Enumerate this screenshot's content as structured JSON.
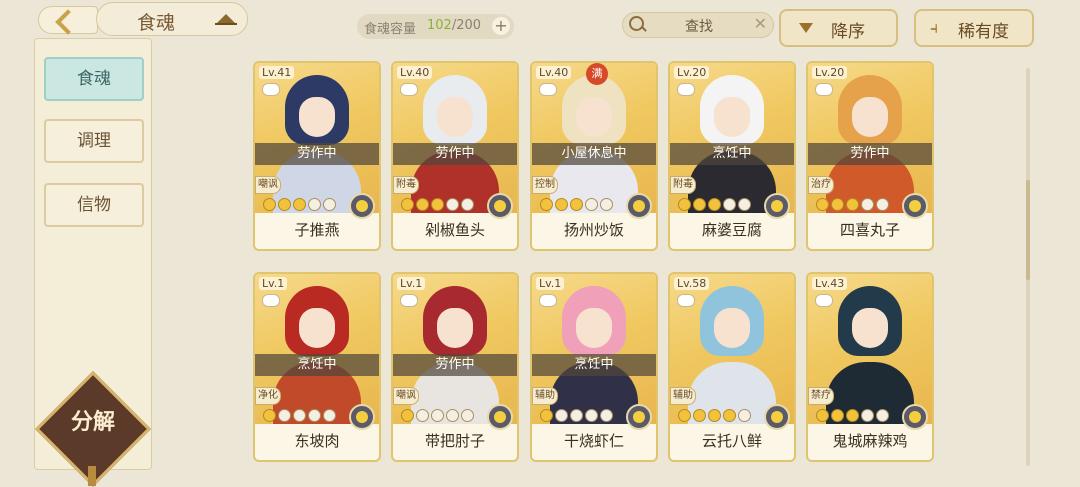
{
  "header": {
    "title": "食魂",
    "capacity_label": "食魂容量",
    "capacity_current": "102",
    "capacity_total": "/200",
    "add_label": "+",
    "search_label": "查找",
    "search_clear": "✕",
    "sort_label": "降序",
    "rarity_label": "稀有度",
    "rarity_icon": "⫞"
  },
  "sidebar": {
    "items": [
      {
        "label": "食魂",
        "active": true
      },
      {
        "label": "调理",
        "active": false
      },
      {
        "label": "信物",
        "active": false
      }
    ],
    "decompose_label": "分解"
  },
  "cards": [
    {
      "level": "Lv.41",
      "status": "劳作中",
      "tag": "嘲讽",
      "stars": 3,
      "name": "子推燕",
      "hair": "#2d3a66",
      "body": "#cfd6e6"
    },
    {
      "level": "Lv.40",
      "status": "劳作中",
      "tag": "附毒",
      "stars": 3,
      "name": "剁椒鱼头",
      "hair": "#e9ecef",
      "body": "#b0302a"
    },
    {
      "level": "Lv.40",
      "status": "小屋休息中",
      "tag": "控制",
      "stars": 3,
      "name": "扬州炒饭",
      "hair": "#efe2c0",
      "body": "#e8e8ee",
      "seal": "满"
    },
    {
      "level": "Lv.20",
      "status": "烹饪中",
      "tag": "附毒",
      "stars": 3,
      "name": "麻婆豆腐",
      "hair": "#f4f4f4",
      "body": "#2a2a30"
    },
    {
      "level": "Lv.20",
      "status": "劳作中",
      "tag": "治疗",
      "stars": 3,
      "name": "四喜丸子",
      "hair": "#e6a24a",
      "body": "#d15a2a"
    },
    {
      "level": "Lv.1",
      "status": "烹饪中",
      "tag": "净化",
      "stars": 1,
      "name": "东坡肉",
      "hair": "#b82a22",
      "body": "#c04a2a"
    },
    {
      "level": "Lv.1",
      "status": "劳作中",
      "tag": "嘲讽",
      "stars": 1,
      "name": "带把肘子",
      "hair": "#a82a30",
      "body": "#e8e4e0"
    },
    {
      "level": "Lv.1",
      "status": "烹饪中",
      "tag": "辅助",
      "stars": 1,
      "name": "干烧虾仁",
      "hair": "#f0a0b8",
      "body": "#303048"
    },
    {
      "level": "Lv.58",
      "status": "",
      "tag": "辅助",
      "stars": 4,
      "name": "云托八鲜",
      "hair": "#8fc4dc",
      "body": "#dfe4ea"
    },
    {
      "level": "Lv.43",
      "status": "",
      "tag": "禁疗",
      "stars": 3,
      "name": "鬼城麻辣鸡",
      "hair": "#233a4a",
      "body": "#1e2a34"
    }
  ]
}
